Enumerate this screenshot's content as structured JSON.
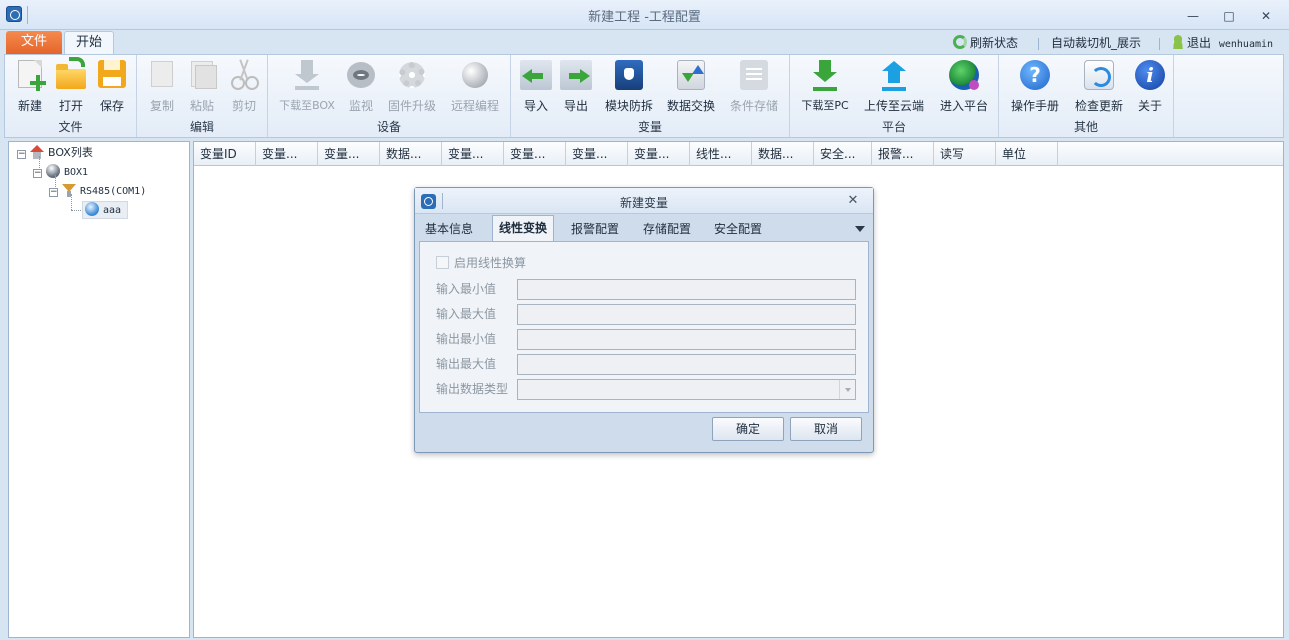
{
  "window": {
    "title": "新建工程 -工程配置",
    "controls": {
      "minimize": "—",
      "maximize": "□",
      "close": "✕"
    }
  },
  "ribbon_tabs": {
    "file": "文件",
    "start": "开始"
  },
  "top_right": {
    "refresh": "刷新状态",
    "auto_switch": "自动裁切机_展示",
    "logout": "退出",
    "username": "wenhuamin"
  },
  "groups": {
    "file": {
      "label": "文件",
      "new": "新建",
      "open": "打开",
      "save": "保存"
    },
    "edit": {
      "label": "编辑",
      "copy": "复制",
      "paste": "粘贴",
      "cut": "剪切"
    },
    "device": {
      "label": "设备",
      "download_box": "下载至BOX",
      "monitor": "监视",
      "firmware": "固件升级",
      "remote": "远程编程"
    },
    "variable": {
      "label": "变量",
      "import": "导入",
      "export": "导出",
      "anti_copy": "模块防拆",
      "data_exchange": "数据交换",
      "cond_storage": "条件存储"
    },
    "platform": {
      "label": "平台",
      "download_pc": "下载至PC",
      "upload_cloud": "上传至云端",
      "enter_platform": "进入平台"
    },
    "other": {
      "label": "其他",
      "manual": "操作手册",
      "update": "检查更新",
      "about": "关于"
    }
  },
  "tree": {
    "root": "BOX列表",
    "box": "BOX1",
    "port": "RS485(COM1)",
    "device": "aaa",
    "expander": "−"
  },
  "grid_columns": [
    "变量ID",
    "变量...",
    "变量...",
    "数据...",
    "变量...",
    "变量...",
    "变量...",
    "变量...",
    "线性...",
    "数据...",
    "安全...",
    "报警...",
    "读写",
    "单位"
  ],
  "dialog": {
    "title": "新建变量",
    "close": "✕",
    "tabs": [
      "基本信息",
      "线性变换",
      "报警配置",
      "存储配置",
      "安全配置"
    ],
    "active_tab": "线性变换",
    "enable_linear": "启用线性换算",
    "fields": {
      "in_min": "输入最小值",
      "in_max": "输入最大值",
      "out_min": "输出最小值",
      "out_max": "输出最大值",
      "out_type": "输出数据类型"
    },
    "ok": "确定",
    "cancel": "取消"
  }
}
